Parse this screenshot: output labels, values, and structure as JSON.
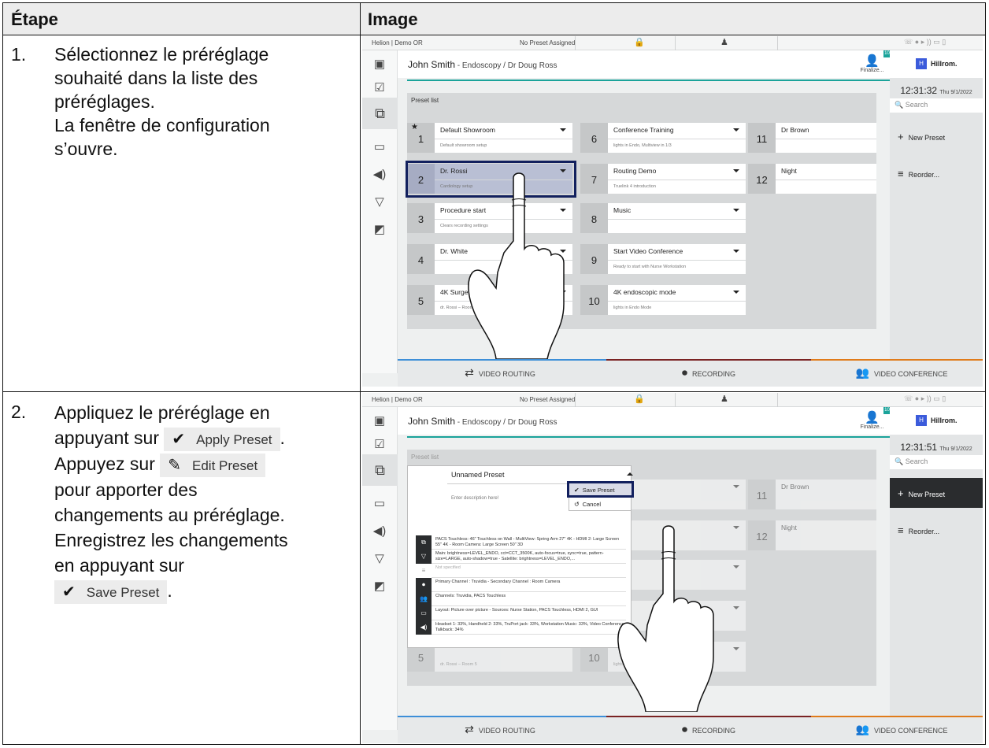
{
  "table": {
    "col_step": "Étape",
    "col_image": "Image"
  },
  "steps": [
    {
      "number": "1.",
      "lines": [
        "Sélectionnez le préréglage",
        "souhaité dans la liste des",
        "préréglages.",
        "La fenêtre de configuration",
        "s’ouvre."
      ]
    },
    {
      "number": "2.",
      "line1": "Appliquez le préréglage en",
      "line2a": "appuyant sur",
      "apply_btn": "Apply Preset",
      "line3a": "Appuyez sur",
      "edit_btn": "Edit Preset",
      "line4": "pour apporter des",
      "line5": "changements au préréglage.",
      "line6": "Enregistrez les changements",
      "line7": "en appuyant sur",
      "save_btn": "Save Preset",
      "period": "."
    }
  ],
  "screens": [
    {
      "topbar": {
        "room": "Helion | Demo OR",
        "preset_status": "No Preset Assigned"
      },
      "patient": {
        "name": "John Smith",
        "detail": " - Endoscopy / Dr Doug Ross"
      },
      "finalize": "Finalize...",
      "badge": "10",
      "logo": "Hillrom.",
      "clock_time": "12:31:32",
      "clock_date": "Thu 9/1/2022",
      "search_placeholder": "Search",
      "btn_new": "New Preset",
      "btn_reorder": "Reorder...",
      "list_label": "Preset list",
      "presets": [
        {
          "num": "1",
          "title": "Default Showroom",
          "desc": "Default showroom setup"
        },
        {
          "num": "2",
          "title": "Dr. Rossi",
          "desc": "Cardiology setup"
        },
        {
          "num": "3",
          "title": "Procedure start",
          "desc": "Clears recording settings"
        },
        {
          "num": "4",
          "title": "Dr. White",
          "desc": ""
        },
        {
          "num": "5",
          "title": "4K Surger",
          "desc": "dr. Rossi – Room 5"
        },
        {
          "num": "6",
          "title": "Conference Training",
          "desc": "lights in Endo, Multiview in 1/3"
        },
        {
          "num": "7",
          "title": "Routing Demo",
          "desc": "Truelink 4 introduction"
        },
        {
          "num": "8",
          "title": "Music",
          "desc": ""
        },
        {
          "num": "9",
          "title": "Start Video Conference",
          "desc": "Ready to start with Nurse Workstation"
        },
        {
          "num": "10",
          "title": "4K endoscopic mode",
          "desc": "lights in Endo Mode"
        },
        {
          "num": "11",
          "title": "Dr Brown",
          "desc": ""
        },
        {
          "num": "12",
          "title": "Night",
          "desc": ""
        }
      ],
      "tabs": [
        "VIDEO ROUTING",
        "RECORDING",
        "VIDEO CONFERENCE"
      ]
    },
    {
      "clock_time": "12:31:51",
      "clock_date": "Thu 9/1/2022",
      "edit_title": "Unnamed Preset",
      "edit_desc": "Enter description here!",
      "menu_save": "Save Preset",
      "menu_cancel": "Cancel",
      "rows": [
        "PACS Touchless: 46\" Touchless on Wall - MultiView: Spring Arm 27\" 4K - HDMI 2: Large Screen 55\" 4K - Room Camera: Large Screen 50\" 3D",
        "Main: brightness=LEVEL_ENDO, cct=CCT_3500K, auto-focus=true, sync=true, pattern-size=LARGE, auto-shadow=true - Satellite: brightness=LEVEL_ENDO,...",
        "Not specified",
        "Primary Channel : Truvidia - Secondary Channel : Room Camera",
        "Channels: Truvidia, PACS Touchless",
        "Layout: Picture over picture - Sources: Nurse Station, PACS Touchless, HDMI 2, GUI",
        "Headset 1: 33%, Handheld 2: 33%, TruPort jack: 33%, Workstation Music: 33%, Video Conference Talkback: 34%"
      ],
      "bg_desc": "dr. Rossi – Room 5",
      "bg_desc2": "lights in En"
    }
  ]
}
